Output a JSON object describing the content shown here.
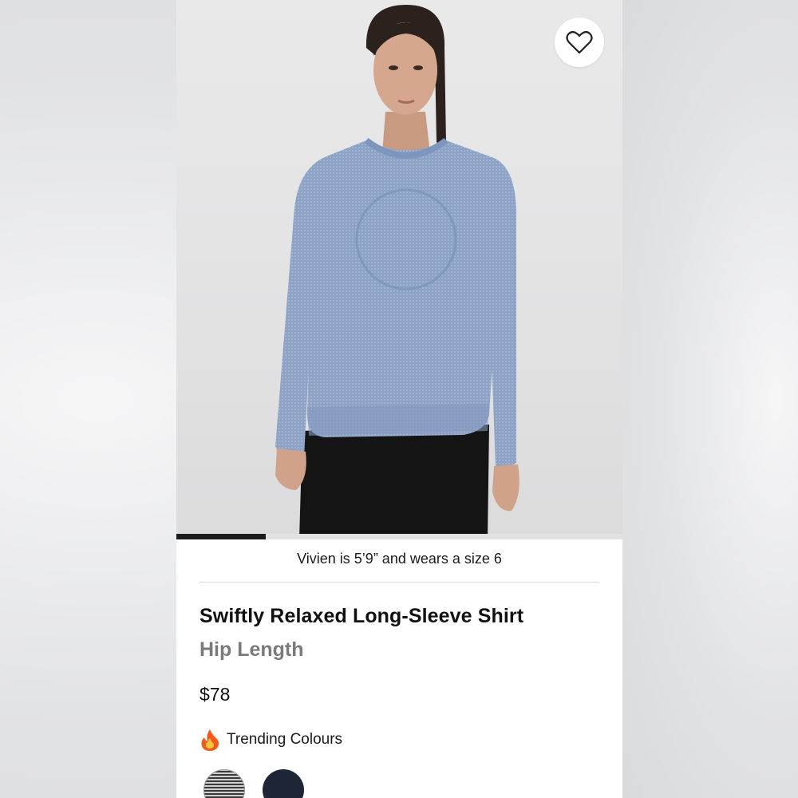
{
  "product": {
    "fit_note": "Vivien is 5’9” and wears a size 6",
    "name": "Swiftly Relaxed Long-Sleeve Shirt",
    "length": "Hip Length",
    "price": "$78"
  },
  "gallery": {
    "progress": 0.2,
    "favorite_icon": "heart-outline-icon"
  },
  "trending": {
    "icon": "fire-icon",
    "label": "Trending Colours",
    "swatches": [
      {
        "name": "heathered-grey-stripe",
        "color": "#8a8a8a"
      },
      {
        "name": "navy",
        "color": "#1e2536"
      }
    ]
  },
  "colors": {
    "shirt": "#8aa0c4",
    "text_primary": "#111111",
    "text_secondary": "#7a7a7a"
  }
}
